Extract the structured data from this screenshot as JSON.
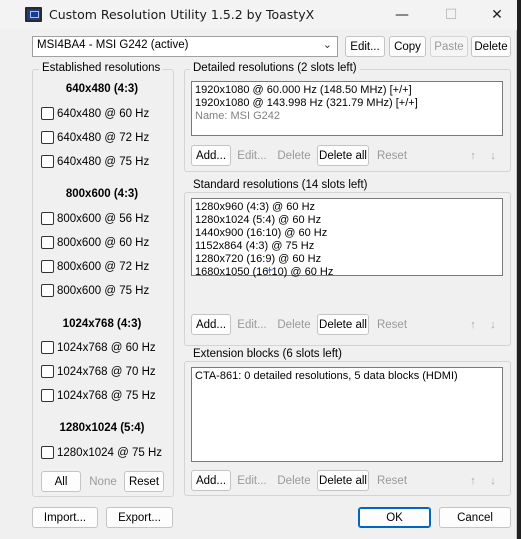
{
  "window": {
    "title": "Custom Resolution Utility 1.5.2 by ToastyX",
    "minimize": "—",
    "maximize": "☐",
    "close": "✕"
  },
  "monitor": {
    "selected": "MSI4BA4 - MSI G242 (active)",
    "edit_label": "Edit...",
    "copy_label": "Copy",
    "paste_label": "Paste",
    "delete_label": "Delete"
  },
  "established": {
    "title": "Established resolutions",
    "groups": [
      {
        "heading": "640x480 (4:3)",
        "items": [
          "640x480 @ 60 Hz",
          "640x480 @ 72 Hz",
          "640x480 @ 75 Hz"
        ]
      },
      {
        "heading": "800x600 (4:3)",
        "items": [
          "800x600 @ 56 Hz",
          "800x600 @ 60 Hz",
          "800x600 @ 72 Hz",
          "800x600 @ 75 Hz"
        ]
      },
      {
        "heading": "1024x768 (4:3)",
        "items": [
          "1024x768 @ 60 Hz",
          "1024x768 @ 70 Hz",
          "1024x768 @ 75 Hz"
        ]
      },
      {
        "heading": "1280x1024 (5:4)",
        "items": [
          "1280x1024 @ 75 Hz"
        ]
      }
    ],
    "all_label": "All",
    "none_label": "None",
    "reset_label": "Reset"
  },
  "detailed": {
    "title": "Detailed resolutions (2 slots left)",
    "items": [
      "1920x1080 @ 60.000 Hz (148.50 MHz) [+/+]",
      "1920x1080 @ 143.998 Hz (321.79 MHz) [+/+]"
    ],
    "name_line": "Name: MSI G242"
  },
  "standard": {
    "title": "Standard resolutions (14 slots left)",
    "items": [
      "1280x960 (4:3) @ 60 Hz",
      "1280x1024 (5:4) @ 60 Hz",
      "1440x900 (16:10) @ 60 Hz",
      "1152x864 (4:3) @ 75 Hz",
      "1280x720 (16:9) @ 60 Hz",
      "1680x1050 (16:10) @ 60 Hz"
    ]
  },
  "extension": {
    "title": "Extension blocks (6 slots left)",
    "items": [
      "CTA-861: 0 detailed resolutions, 5 data blocks (HDMI)"
    ]
  },
  "list_buttons": {
    "add": "Add...",
    "edit": "Edit...",
    "delete": "Delete",
    "delete_all": "Delete all",
    "reset": "Reset",
    "up": "↑",
    "down": "↓"
  },
  "footer": {
    "import_label": "Import...",
    "export_label": "Export...",
    "ok_label": "OK",
    "cancel_label": "Cancel"
  }
}
